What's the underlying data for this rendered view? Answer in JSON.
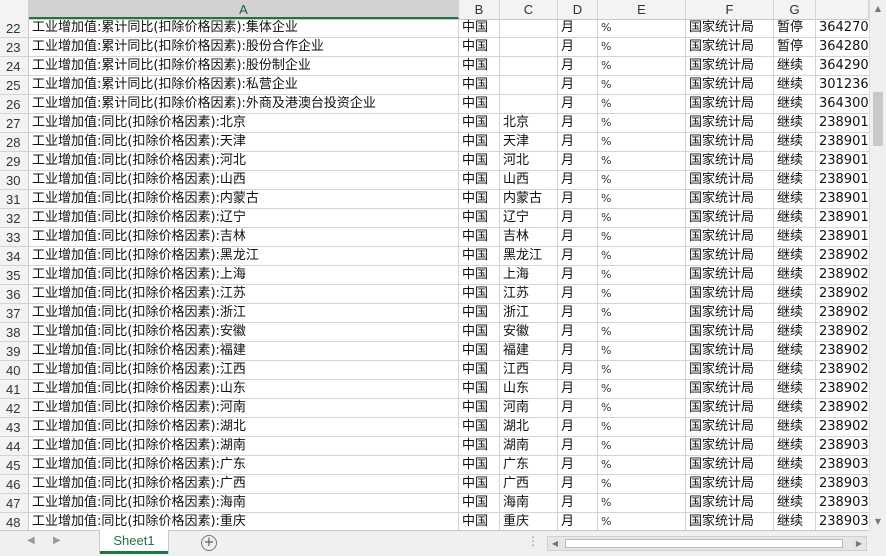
{
  "columns": [
    {
      "letter": "",
      "width": 29
    },
    {
      "letter": "A",
      "width": 430
    },
    {
      "letter": "B",
      "width": 41
    },
    {
      "letter": "C",
      "width": 58
    },
    {
      "letter": "D",
      "width": 40
    },
    {
      "letter": "E",
      "width": 88
    },
    {
      "letter": "F",
      "width": 88
    },
    {
      "letter": "G",
      "width": 42
    },
    {
      "letter": "",
      "width": 53
    }
  ],
  "selected_column": "A",
  "rows": [
    {
      "num": "22",
      "cells": [
        "工业增加值:累计同比(扣除价格因素):集体企业",
        "中国",
        "",
        "月",
        "%",
        "国家统计局",
        "暂停",
        "364270"
      ]
    },
    {
      "num": "23",
      "cells": [
        "工业增加值:累计同比(扣除价格因素):股份合作企业",
        "中国",
        "",
        "月",
        "%",
        "国家统计局",
        "暂停",
        "364280"
      ]
    },
    {
      "num": "24",
      "cells": [
        "工业增加值:累计同比(扣除价格因素):股份制企业",
        "中国",
        "",
        "月",
        "%",
        "国家统计局",
        "继续",
        "364290"
      ]
    },
    {
      "num": "25",
      "cells": [
        "工业增加值:累计同比(扣除价格因素):私营企业",
        "中国",
        "",
        "月",
        "%",
        "国家统计局",
        "继续",
        "301236"
      ]
    },
    {
      "num": "26",
      "cells": [
        "工业增加值:累计同比(扣除价格因素):外商及港澳台投资企业",
        "中国",
        "",
        "月",
        "%",
        "国家统计局",
        "继续",
        "364300"
      ]
    },
    {
      "num": "27",
      "cells": [
        "工业增加值:同比(扣除价格因素):北京",
        "中国",
        "北京",
        "月",
        "%",
        "国家统计局",
        "继续",
        "238901"
      ]
    },
    {
      "num": "28",
      "cells": [
        "工业增加值:同比(扣除价格因素):天津",
        "中国",
        "天津",
        "月",
        "%",
        "国家统计局",
        "继续",
        "238901"
      ]
    },
    {
      "num": "29",
      "cells": [
        "工业增加值:同比(扣除价格因素):河北",
        "中国",
        "河北",
        "月",
        "%",
        "国家统计局",
        "继续",
        "238901"
      ]
    },
    {
      "num": "30",
      "cells": [
        "工业增加值:同比(扣除价格因素):山西",
        "中国",
        "山西",
        "月",
        "%",
        "国家统计局",
        "继续",
        "238901"
      ]
    },
    {
      "num": "31",
      "cells": [
        "工业增加值:同比(扣除价格因素):内蒙古",
        "中国",
        "内蒙古",
        "月",
        "%",
        "国家统计局",
        "继续",
        "238901"
      ]
    },
    {
      "num": "32",
      "cells": [
        "工业增加值:同比(扣除价格因素):辽宁",
        "中国",
        "辽宁",
        "月",
        "%",
        "国家统计局",
        "继续",
        "238901"
      ]
    },
    {
      "num": "33",
      "cells": [
        "工业增加值:同比(扣除价格因素):吉林",
        "中国",
        "吉林",
        "月",
        "%",
        "国家统计局",
        "继续",
        "238901"
      ]
    },
    {
      "num": "34",
      "cells": [
        "工业增加值:同比(扣除价格因素):黑龙江",
        "中国",
        "黑龙江",
        "月",
        "%",
        "国家统计局",
        "继续",
        "238902"
      ]
    },
    {
      "num": "35",
      "cells": [
        "工业增加值:同比(扣除价格因素):上海",
        "中国",
        "上海",
        "月",
        "%",
        "国家统计局",
        "继续",
        "238902"
      ]
    },
    {
      "num": "36",
      "cells": [
        "工业增加值:同比(扣除价格因素):江苏",
        "中国",
        "江苏",
        "月",
        "%",
        "国家统计局",
        "继续",
        "238902"
      ]
    },
    {
      "num": "37",
      "cells": [
        "工业增加值:同比(扣除价格因素):浙江",
        "中国",
        "浙江",
        "月",
        "%",
        "国家统计局",
        "继续",
        "238902"
      ]
    },
    {
      "num": "38",
      "cells": [
        "工业增加值:同比(扣除价格因素):安徽",
        "中国",
        "安徽",
        "月",
        "%",
        "国家统计局",
        "继续",
        "238902"
      ]
    },
    {
      "num": "39",
      "cells": [
        "工业增加值:同比(扣除价格因素):福建",
        "中国",
        "福建",
        "月",
        "%",
        "国家统计局",
        "继续",
        "238902"
      ]
    },
    {
      "num": "40",
      "cells": [
        "工业增加值:同比(扣除价格因素):江西",
        "中国",
        "江西",
        "月",
        "%",
        "国家统计局",
        "继续",
        "238902"
      ]
    },
    {
      "num": "41",
      "cells": [
        "工业增加值:同比(扣除价格因素):山东",
        "中国",
        "山东",
        "月",
        "%",
        "国家统计局",
        "继续",
        "238902"
      ]
    },
    {
      "num": "42",
      "cells": [
        "工业增加值:同比(扣除价格因素):河南",
        "中国",
        "河南",
        "月",
        "%",
        "国家统计局",
        "继续",
        "238902"
      ]
    },
    {
      "num": "43",
      "cells": [
        "工业增加值:同比(扣除价格因素):湖北",
        "中国",
        "湖北",
        "月",
        "%",
        "国家统计局",
        "继续",
        "238902"
      ]
    },
    {
      "num": "44",
      "cells": [
        "工业增加值:同比(扣除价格因素):湖南",
        "中国",
        "湖南",
        "月",
        "%",
        "国家统计局",
        "继续",
        "238903"
      ]
    },
    {
      "num": "45",
      "cells": [
        "工业增加值:同比(扣除价格因素):广东",
        "中国",
        "广东",
        "月",
        "%",
        "国家统计局",
        "继续",
        "238903"
      ]
    },
    {
      "num": "46",
      "cells": [
        "工业增加值:同比(扣除价格因素):广西",
        "中国",
        "广西",
        "月",
        "%",
        "国家统计局",
        "继续",
        "238903"
      ]
    },
    {
      "num": "47",
      "cells": [
        "工业增加值:同比(扣除价格因素):海南",
        "中国",
        "海南",
        "月",
        "%",
        "国家统计局",
        "继续",
        "238903"
      ]
    },
    {
      "num": "48",
      "cells": [
        "工业增加值:同比(扣除价格因素):重庆",
        "中国",
        "重庆",
        "月",
        "%",
        "国家统计局",
        "继续",
        "238903"
      ]
    }
  ],
  "sheet_tabs": [
    {
      "label": "Sheet1",
      "active": true
    }
  ],
  "accent_color": "#217346",
  "icons": {
    "add_sheet": "plus-circle-icon",
    "scroll_up": "triangle-up-icon",
    "scroll_down": "triangle-down-icon",
    "scroll_left": "triangle-left-icon",
    "scroll_right": "triangle-right-icon"
  }
}
